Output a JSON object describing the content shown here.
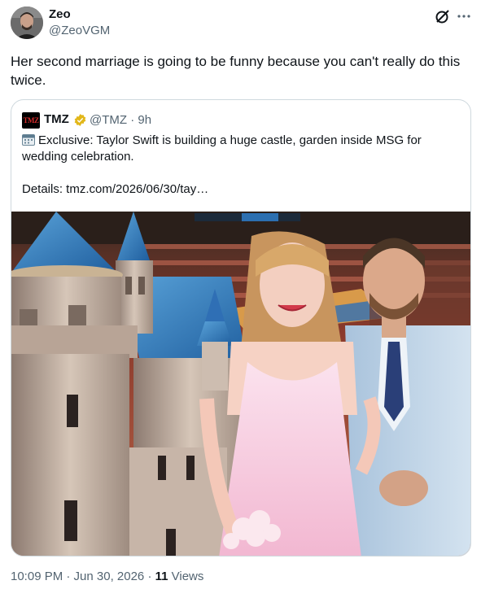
{
  "author": {
    "name": "Zeo",
    "handle": "@ZeoVGM"
  },
  "tweet": {
    "text": "Her second marriage is going to be funny because you can't really do this twice."
  },
  "quote": {
    "logo_text": "TMZ",
    "name": "TMZ",
    "handle_time": "@TMZ · 9h",
    "text": "Exclusive: Taylor Swift is building a huge castle, garden inside MSG for wedding celebration.\n\nDetails: tmz.com/2026/06/30/tay…",
    "verified_color": "#e2b719"
  },
  "footer": {
    "time": "10:09 PM · Jun 30, 2026 · ",
    "views_count": "11",
    "views_label": " Views"
  },
  "colors": {
    "text": "#0f1419",
    "secondary": "#536471",
    "border": "#cfd9de"
  }
}
